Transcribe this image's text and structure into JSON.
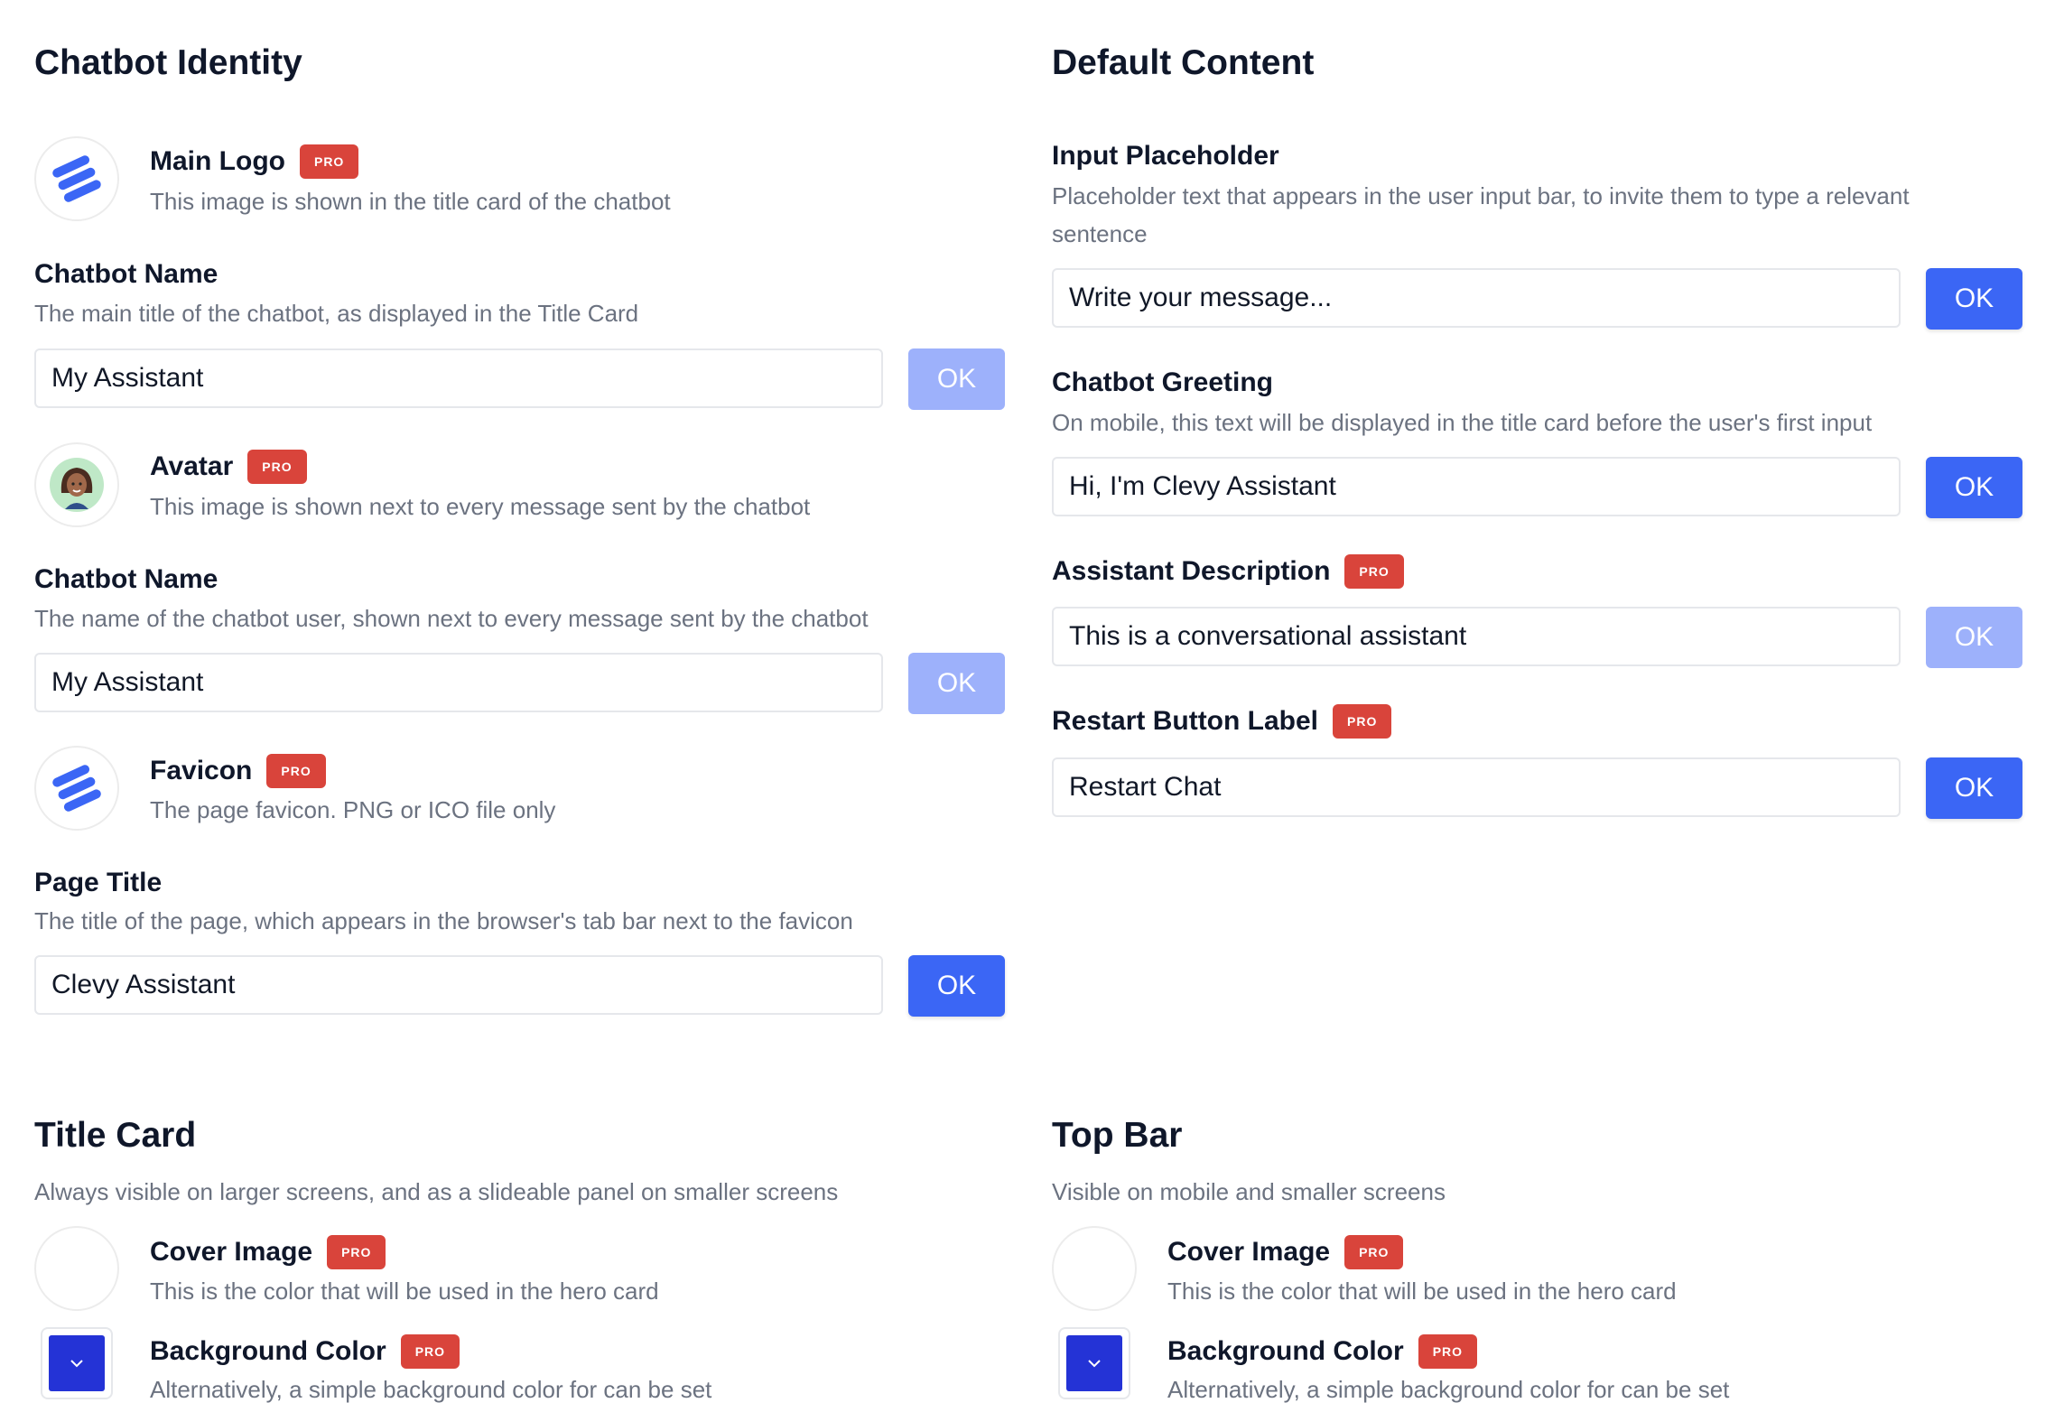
{
  "identity": {
    "title": "Chatbot Identity",
    "main_logo": {
      "label": "Main Logo",
      "badge": "PRO",
      "desc": "This image is shown in the title card of the chatbot",
      "icon": "logo-icon"
    },
    "chatbot_name": {
      "label": "Chatbot Name",
      "desc": "The main title of the chatbot, as displayed in the Title Card",
      "value": "My Assistant",
      "ok": "OK"
    },
    "avatar": {
      "label": "Avatar",
      "badge": "PRO",
      "desc": "This image is shown next to every message sent by the chatbot",
      "icon": "avatar-icon"
    },
    "chatbot_user_name": {
      "label": "Chatbot Name",
      "desc": "The name of the chatbot user, shown next to every message sent by the chatbot",
      "value": "My Assistant",
      "ok": "OK"
    },
    "favicon": {
      "label": "Favicon",
      "badge": "PRO",
      "desc": "The page favicon. PNG or ICO file only",
      "icon": "favicon-icon"
    },
    "page_title": {
      "label": "Page Title",
      "desc": "The title of the page, which appears in the browser's tab bar next to the favicon",
      "value": "Clevy Assistant",
      "ok": "OK"
    }
  },
  "default_content": {
    "title": "Default Content",
    "input_placeholder": {
      "label": "Input Placeholder",
      "desc": "Placeholder text that appears in the user input bar, to invite them to type a relevant sentence",
      "value": "Write your message...",
      "ok": "OK"
    },
    "greeting": {
      "label": "Chatbot Greeting",
      "desc": "On mobile, this text will be displayed in the title card before the user's first input",
      "value": "Hi, I'm Clevy Assistant",
      "ok": "OK"
    },
    "assistant_description": {
      "label": "Assistant Description",
      "badge": "PRO",
      "value": "This is a conversational assistant",
      "ok": "OK"
    },
    "restart_label": {
      "label": "Restart Button Label",
      "badge": "PRO",
      "value": "Restart Chat",
      "ok": "OK"
    }
  },
  "title_card": {
    "title": "Title Card",
    "desc": "Always visible on larger screens, and as a slideable panel on smaller screens",
    "cover_image": {
      "label": "Cover Image",
      "badge": "PRO",
      "desc": "This is the color that will be used in the hero card"
    },
    "background_color": {
      "label": "Background Color",
      "badge": "PRO",
      "desc": "Alternatively, a simple background color for can be set",
      "color": "#2433d6"
    }
  },
  "top_bar": {
    "title": "Top Bar",
    "desc": "Visible on mobile and smaller screens",
    "cover_image": {
      "label": "Cover Image",
      "badge": "PRO",
      "desc": "This is the color that will be used in the hero card"
    },
    "background_color": {
      "label": "Background Color",
      "badge": "PRO",
      "desc": "Alternatively, a simple background color for can be set",
      "color": "#2433d6"
    }
  },
  "colors": {
    "accent": "#3b66f5",
    "accent_disabled": "#9db1fb",
    "pro_badge": "#d9443b"
  }
}
